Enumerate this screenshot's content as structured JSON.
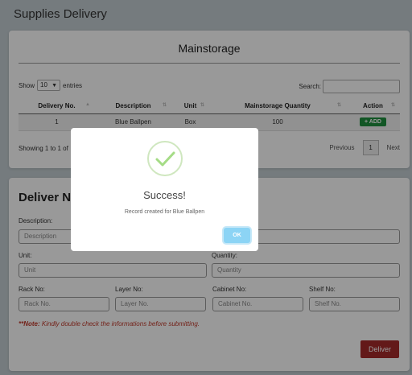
{
  "page": {
    "title": "Supplies Delivery"
  },
  "mainstorage": {
    "heading": "Mainstorage",
    "length": {
      "show": "Show",
      "value": "10",
      "entries": "entries"
    },
    "search": {
      "label": "Search:",
      "value": ""
    },
    "columns": [
      "Delivery No.",
      "Description",
      "Unit",
      "Mainstorage Quantity",
      "Action"
    ],
    "rows": [
      {
        "delivery_no": "1",
        "description": "Blue Ballpen",
        "unit": "Box",
        "quantity": "100",
        "action": "+ ADD"
      }
    ],
    "info": "Showing 1 to 1 of",
    "pagination": {
      "previous": "Previous",
      "page": "1",
      "next": "Next"
    }
  },
  "deliver_form": {
    "title": "Deliver Ne",
    "description": {
      "label": "Description:",
      "placeholder": "Description"
    },
    "unit": {
      "label": "Unit:",
      "placeholder": "Unit"
    },
    "quantity": {
      "label": "Quantity:",
      "placeholder": "Quantity"
    },
    "rack": {
      "label": "Rack No:",
      "placeholder": "Rack No."
    },
    "layer": {
      "label": "Layer No:",
      "placeholder": "Layer No."
    },
    "cabinet": {
      "label": "Cabinet No:",
      "placeholder": "Cabinet No."
    },
    "shelf": {
      "label": "Shelf No:",
      "placeholder": "Shelf No."
    },
    "note_prefix": "**Note:",
    "note_text": " Kindly double check the informations before submitting.",
    "submit": "Deliver"
  },
  "modal": {
    "title": "Success!",
    "message": "Record created for Blue Ballpen",
    "ok": "OK",
    "icon": "check-icon"
  },
  "colors": {
    "add_button": "#1f8f3e",
    "deliver_button": "#a52a2a",
    "ok_button": "#8cd4f5",
    "success_check": "#a5dc86",
    "note": "#c0392b"
  }
}
